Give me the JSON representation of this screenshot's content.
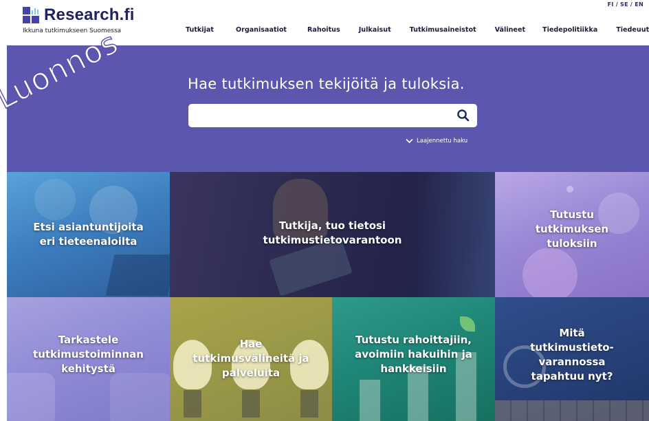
{
  "header": {
    "logo_text": "Research.fi",
    "logo_subtitle": "Ikkuna tutkimukseen Suomessa",
    "languages": "FI / SE / EN",
    "nav": [
      "Tutkijat",
      "Organisaatiot",
      "Rahoitus",
      "Julkaisut",
      "Tutkimusaineistot",
      "Välineet",
      "Tiedepolitiikka",
      "Tiedeuutisia"
    ]
  },
  "hero": {
    "title": "Hae tutkimuksen tekijöitä ja tuloksia.",
    "search_value": "",
    "advanced_search": "Laajennettu haku"
  },
  "tiles": {
    "t1": [
      "Etsi asiantuntijoita",
      "eri tieteenaloilta"
    ],
    "t2": [
      "Tutkija, tuo tietosi",
      "tutkimustietovarantoon"
    ],
    "t3": [
      "Tutustu",
      "tutkimuksen",
      "tuloksiin"
    ],
    "t4": [
      "Tarkastele",
      "tutkimustoiminnan",
      "kehitystä"
    ],
    "t5": [
      "Hae",
      "tutkimusvälineitä ja",
      "palveluita"
    ],
    "t6": [
      "Tutustu rahoittajiin,",
      "avoimiin hakuihin ja",
      "hankkeisiin"
    ],
    "t7": [
      "Mitä",
      "tutkimustieto-",
      "varannossa",
      "tapahtuu nyt?"
    ]
  },
  "watermark": "Luonnos",
  "colors": {
    "hero": "#5b57ae",
    "brand_dark": "#1f2460",
    "accent_blue": "#4543a6"
  }
}
